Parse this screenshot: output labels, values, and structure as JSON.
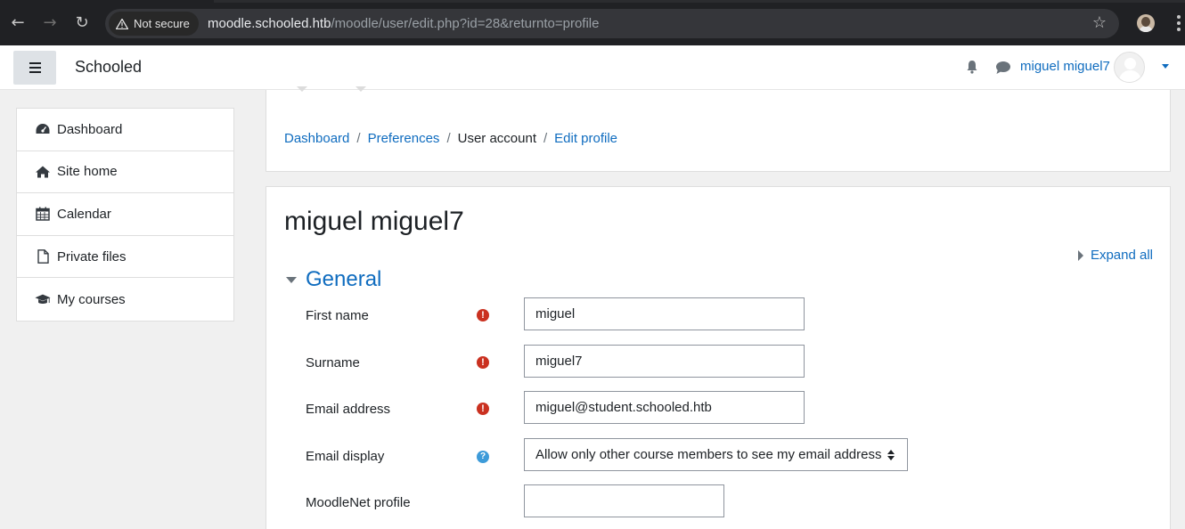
{
  "browser": {
    "security_label": "Not secure",
    "url_host": "moodle.schooled.htb",
    "url_path": "/moodle/user/edit.php?id=28&returnto=profile"
  },
  "navbar": {
    "brand": "Schooled",
    "username": "miguel miguel7"
  },
  "drawer": {
    "items": [
      {
        "label": "Dashboard",
        "icon": "dashboard-icon"
      },
      {
        "label": "Site home",
        "icon": "home-icon"
      },
      {
        "label": "Calendar",
        "icon": "calendar-icon"
      },
      {
        "label": "Private files",
        "icon": "file-icon"
      },
      {
        "label": "My courses",
        "icon": "graduation-cap-icon"
      }
    ]
  },
  "breadcrumb": {
    "items": [
      "Dashboard",
      "Preferences",
      "User account",
      "Edit profile"
    ]
  },
  "page": {
    "title": "miguel miguel7",
    "expand_all": "Expand all",
    "section_title": "General"
  },
  "form": {
    "first_name": {
      "label": "First name",
      "value": "miguel"
    },
    "surname": {
      "label": "Surname",
      "value": "miguel7"
    },
    "email": {
      "label": "Email address",
      "value": "miguel@student.schooled.htb"
    },
    "email_display": {
      "label": "Email display",
      "value": "Allow only other course members to see my email address"
    },
    "moodlenet": {
      "label": "MoodleNet profile",
      "value": ""
    }
  },
  "colors": {
    "link": "#0f6cbf",
    "required": "#ca3120",
    "help": "#3d9bd9"
  }
}
